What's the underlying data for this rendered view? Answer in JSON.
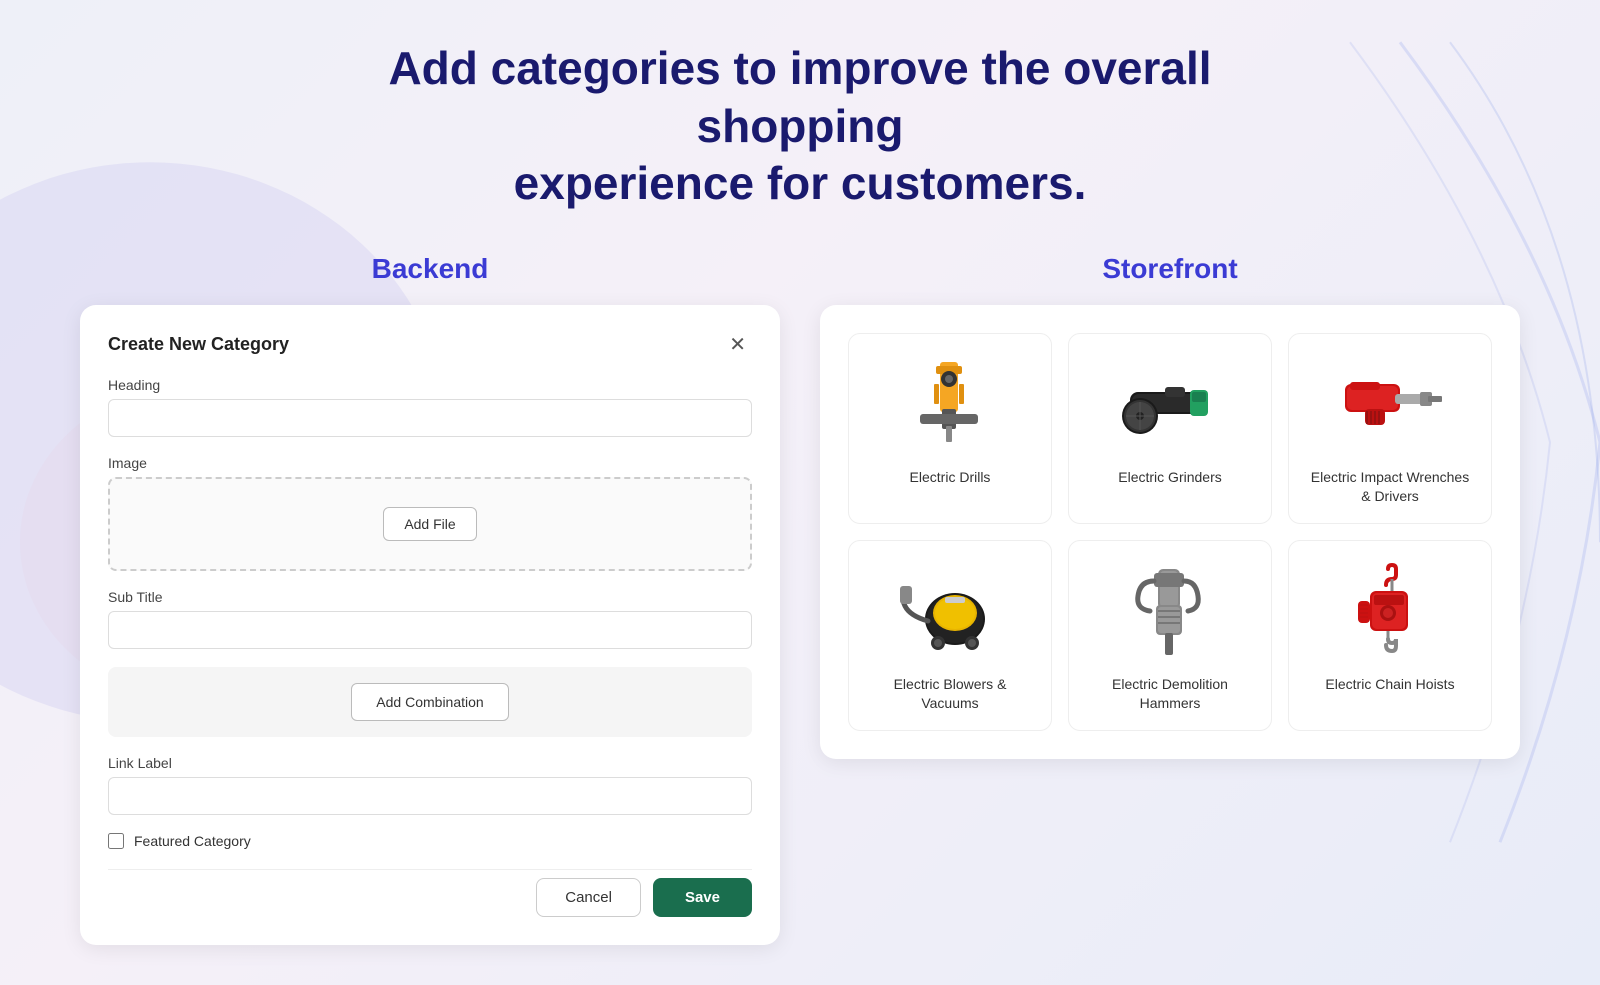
{
  "page": {
    "title_line1": "Add categories to improve the overall shopping",
    "title_line2": "experience for customers."
  },
  "backend": {
    "column_label": "Backend",
    "panel_title": "Create New Category",
    "fields": {
      "heading_label": "Heading",
      "heading_placeholder": "",
      "image_label": "Image",
      "add_file_label": "Add File",
      "subtitle_label": "Sub Title",
      "subtitle_placeholder": "",
      "add_combination_label": "Add Combination",
      "link_label_label": "Link Label",
      "link_label_placeholder": "",
      "featured_category_label": "Featured Category"
    },
    "actions": {
      "cancel_label": "Cancel",
      "save_label": "Save"
    }
  },
  "storefront": {
    "column_label": "Storefront",
    "categories": [
      {
        "id": "electric-drills",
        "name": "Electric Drills",
        "icon": "drill"
      },
      {
        "id": "electric-grinders",
        "name": "Electric Grinders",
        "icon": "grinder"
      },
      {
        "id": "electric-impact-wrenches",
        "name": "Electric Impact Wrenches & Drivers",
        "icon": "wrench"
      },
      {
        "id": "electric-blowers-vacuums",
        "name": "Electric Blowers & Vacuums",
        "icon": "vacuum"
      },
      {
        "id": "electric-demolition-hammers",
        "name": "Electric Demolition Hammers",
        "icon": "hammer"
      },
      {
        "id": "electric-chain-hoists",
        "name": "Electric Chain Hoists",
        "icon": "hoist"
      }
    ]
  }
}
